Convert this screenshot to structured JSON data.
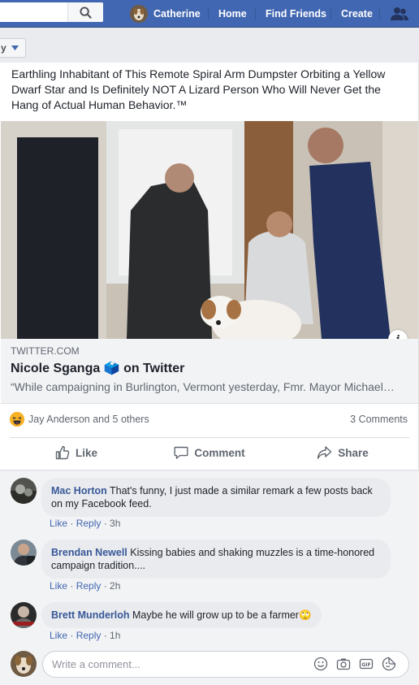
{
  "topbar": {
    "profile_name": "Catherine",
    "nav_home": "Home",
    "nav_find_friends": "Find Friends",
    "nav_create": "Create"
  },
  "filter": {
    "label": "y"
  },
  "post": {
    "text": "Earthling Inhabitant of This Remote Spiral Arm Dumpster Orbiting a Yellow Dwarf Star and Is Definitely NOT A Lizard Person Who Will Never Get the Hang of Actual Human Behavior.™",
    "link": {
      "domain": "TWITTER.COM",
      "title": "Nicole Sganga 🗳️ on Twitter",
      "description": "“While campaigning in Burlington, Vermont yesterday, Fmr. Mayor Michael…"
    },
    "reactions_text": "Jay Anderson and 5 others",
    "comments_count": "3 Comments",
    "actions": {
      "like": "Like",
      "comment": "Comment",
      "share": "Share"
    }
  },
  "comments": [
    {
      "name": "Mac Horton",
      "text": "That's funny, I just made a similar remark a few posts back on my Facebook feed.",
      "like": "Like",
      "reply": "Reply",
      "time": "3h"
    },
    {
      "name": "Brendan Newell",
      "text": "Kissing babies and shaking muzzles is a time-honored campaign tradition....",
      "like": "Like",
      "reply": "Reply",
      "time": "2h"
    },
    {
      "name": "Brett Munderloh",
      "text": "Maybe he will grow up to be a farmer🙄",
      "like": "Like",
      "reply": "Reply",
      "time": "1h"
    }
  ],
  "composer": {
    "placeholder": "Write a comment..."
  },
  "colors": {
    "brand": "#4267b2",
    "link_name": "#385898",
    "muted": "#606770"
  }
}
